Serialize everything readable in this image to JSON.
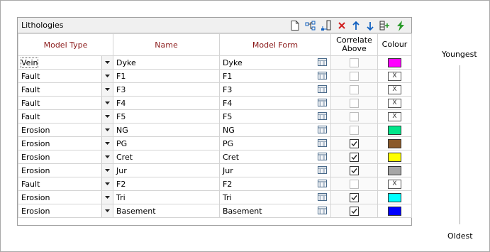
{
  "panel": {
    "title": "Lithologies"
  },
  "toolbar": {
    "icons": [
      "new-icon",
      "tree-icon",
      "insert-icon",
      "delete-icon",
      "move-up-icon",
      "move-down-icon",
      "add-column-icon",
      "lightning-icon"
    ]
  },
  "columns": {
    "model_type": "Model Type",
    "name": "Name",
    "model_form": "Model Form",
    "correlate_above_1": "Correlate",
    "correlate_above_2": "Above",
    "colour": "Colour"
  },
  "rows": [
    {
      "type": "Vein",
      "name": "Dyke",
      "form": "Dyke",
      "correlate": false,
      "correlate_enabled": false,
      "colour": "#ff00ff",
      "colour_label": ""
    },
    {
      "type": "Fault",
      "name": "F1",
      "form": "F1",
      "correlate": false,
      "correlate_enabled": false,
      "colour": null,
      "colour_label": "X"
    },
    {
      "type": "Fault",
      "name": "F3",
      "form": "F3",
      "correlate": false,
      "correlate_enabled": false,
      "colour": null,
      "colour_label": "X"
    },
    {
      "type": "Fault",
      "name": "F4",
      "form": "F4",
      "correlate": false,
      "correlate_enabled": false,
      "colour": null,
      "colour_label": "X"
    },
    {
      "type": "Fault",
      "name": "F5",
      "form": "F5",
      "correlate": false,
      "correlate_enabled": false,
      "colour": null,
      "colour_label": "X"
    },
    {
      "type": "Erosion",
      "name": "NG",
      "form": "NG",
      "correlate": false,
      "correlate_enabled": false,
      "colour": "#00e68a",
      "colour_label": ""
    },
    {
      "type": "Erosion",
      "name": "PG",
      "form": "PG",
      "correlate": true,
      "correlate_enabled": true,
      "colour": "#8b5a2b",
      "colour_label": ""
    },
    {
      "type": "Erosion",
      "name": "Cret",
      "form": "Cret",
      "correlate": true,
      "correlate_enabled": true,
      "colour": "#ffff00",
      "colour_label": ""
    },
    {
      "type": "Erosion",
      "name": "Jur",
      "form": "Jur",
      "correlate": true,
      "correlate_enabled": true,
      "colour": "#a6a6a6",
      "colour_label": ""
    },
    {
      "type": "Fault",
      "name": "F2",
      "form": "F2",
      "correlate": false,
      "correlate_enabled": false,
      "colour": null,
      "colour_label": "X"
    },
    {
      "type": "Erosion",
      "name": "Tri",
      "form": "Tri",
      "correlate": true,
      "correlate_enabled": true,
      "colour": "#00ffff",
      "colour_label": ""
    },
    {
      "type": "Erosion",
      "name": "Basement",
      "form": "Basement",
      "correlate": true,
      "correlate_enabled": true,
      "colour": "#0000ff",
      "colour_label": ""
    }
  ],
  "age_scale": {
    "top": "Youngest",
    "bottom": "Oldest"
  },
  "colors": {
    "header_text": "#8b1a1a",
    "delete_icon": "#d02020",
    "arrow_icon": "#1060c0",
    "lightning_icon": "#2a9a2a"
  }
}
